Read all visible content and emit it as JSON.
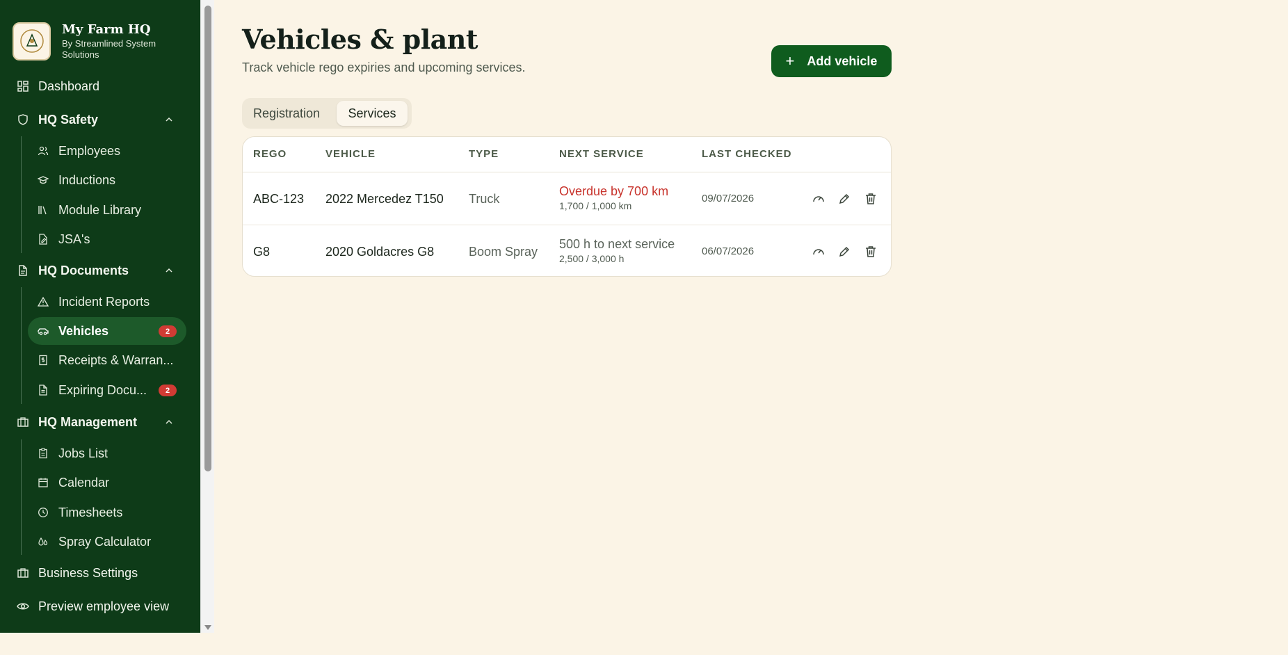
{
  "sidebar": {
    "brand_title": "My Farm HQ",
    "brand_sub": "By Streamlined System Solutions",
    "dashboard": "Dashboard",
    "hq_safety": "HQ Safety",
    "safety_items": [
      "Employees",
      "Inductions",
      "Module Library",
      "JSA's"
    ],
    "hq_documents": "HQ Documents",
    "documents_items": [
      "Incident Reports",
      "Vehicles",
      "Receipts & Warran...",
      "Expiring Docu..."
    ],
    "vehicles_badge": "2",
    "expiring_badge": "2",
    "hq_management": "HQ Management",
    "management_items": [
      "Jobs List",
      "Calendar",
      "Timesheets",
      "Spray Calculator"
    ],
    "business_settings": "Business Settings",
    "preview": "Preview employee view"
  },
  "page": {
    "title": "Vehicles & plant",
    "subtitle": "Track vehicle rego expiries and upcoming services.",
    "add_button": "Add vehicle"
  },
  "tabs": [
    "Registration",
    "Services"
  ],
  "active_tab": "Services",
  "table": {
    "headers": [
      "REGO",
      "VEHICLE",
      "TYPE",
      "NEXT SERVICE",
      "LAST CHECKED"
    ],
    "rows": [
      {
        "rego": "ABC-123",
        "vehicle": "2022 Mercedez T150",
        "type": "Truck",
        "next_service": "Overdue by 700 km",
        "next_detail": "1,700 / 1,000 km",
        "last_checked": "09/07/2026",
        "status": "overdue"
      },
      {
        "rego": "G8",
        "vehicle": "2020 Goldacres G8",
        "type": "Boom Spray",
        "next_service": "500 h to next service",
        "next_detail": "2,500 / 3,000 h",
        "last_checked": "06/07/2026",
        "status": "ok"
      }
    ]
  },
  "colors": {
    "sidebar_bg": "#0e3b18",
    "accent": "#0f5c1e",
    "overdue": "#c8332c",
    "page_bg": "#fbf4e6"
  },
  "icons": [
    "dashboard-icon",
    "shield-icon",
    "users-icon",
    "graduation-cap-icon",
    "library-icon",
    "file-edit-icon",
    "file-icon",
    "alert-triangle-icon",
    "car-icon",
    "receipt-icon",
    "file-text-icon",
    "briefcase-icon",
    "clipboard-icon",
    "calendar-icon",
    "clock-icon",
    "droplets-icon",
    "building-icon",
    "eye-icon",
    "chevron-up-icon",
    "plus-icon",
    "gauge-icon",
    "pencil-icon",
    "trash-icon"
  ]
}
